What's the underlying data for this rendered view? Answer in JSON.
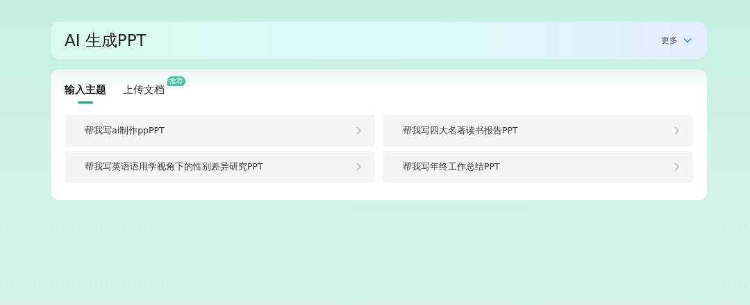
{
  "header": {
    "title": "AI 生成PPT",
    "more": "更多"
  },
  "tabs": [
    {
      "label": "输入主题",
      "selected": true
    },
    {
      "label": "上传文档",
      "selected": false,
      "badge": "推荐"
    }
  ],
  "suggestions": [
    "帮我写ai制作ppPPT",
    "帮我写四大名著读书报告PPT",
    "帮我写英语语用学视角下的性别差异研究PPT",
    "帮我写年终工作总结PPT"
  ]
}
